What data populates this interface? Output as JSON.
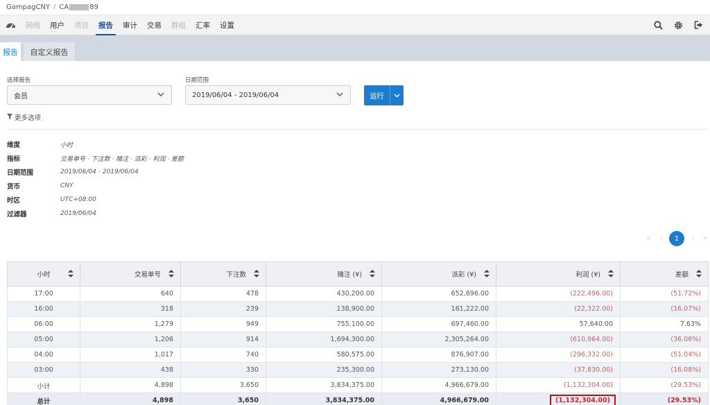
{
  "breadcrumb": {
    "root": "GampagCNY",
    "separator": "/",
    "current_prefix": "CA",
    "current_suffix": "89"
  },
  "nav": {
    "items": [
      {
        "label": "网络",
        "dim": true
      },
      {
        "label": "用户",
        "dim": false
      },
      {
        "label": "项目",
        "dim": true
      },
      {
        "label": "报告",
        "dim": false,
        "active": true
      },
      {
        "label": "审计",
        "dim": false
      },
      {
        "label": "交易",
        "dim": false
      },
      {
        "label": "群组",
        "dim": true
      },
      {
        "label": "汇率",
        "dim": false
      },
      {
        "label": "设置",
        "dim": false
      }
    ]
  },
  "tabs": {
    "reports": "报告",
    "custom": "自定义报告"
  },
  "filters": {
    "report_label": "选择报告",
    "report_value": "会员",
    "date_label": "日期范围",
    "date_value": "2019/06/04 - 2019/06/04",
    "run_label": "运行",
    "more_options": "更多选项"
  },
  "summary": [
    {
      "key": "维度",
      "value": "小时"
    },
    {
      "key": "指标",
      "value": "交易单号 · 下注数 · 赌注 · 派彩 · 利润 · 差额"
    },
    {
      "key": "日期范围",
      "value": "2019/06/04 - 2019/06/04"
    },
    {
      "key": "货币",
      "value": "CNY"
    },
    {
      "key": "时区",
      "value": "UTC+08:00"
    },
    {
      "key": "过滤器",
      "value": "2019/06/04"
    }
  ],
  "pagination": {
    "prev": "‹",
    "first": "«",
    "current": "1",
    "next": "›",
    "last": "»"
  },
  "table": {
    "headers": [
      "小时",
      "交易单号",
      "下注数",
      "赌注 (¥)",
      "派彩 (¥)",
      "利润 (¥)",
      "差额"
    ],
    "rows": [
      [
        "17:00",
        "640",
        "478",
        "430,200.00",
        "652,696.00",
        "(222,496.00)",
        "(51.72%)"
      ],
      [
        "16:00",
        "318",
        "239",
        "138,900.00",
        "161,222.00",
        "(22,322.00)",
        "(16.07%)"
      ],
      [
        "06:00",
        "1,279",
        "949",
        "755,100.00",
        "697,460.00",
        "57,640.00",
        "7.63%"
      ],
      [
        "05:00",
        "1,206",
        "914",
        "1,694,300.00",
        "2,305,264.00",
        "(610,964.00)",
        "(36.06%)"
      ],
      [
        "04:00",
        "1,017",
        "740",
        "580,575.00",
        "876,907.00",
        "(296,332.00)",
        "(51.04%)"
      ],
      [
        "03:00",
        "438",
        "330",
        "235,300.00",
        "273,130.00",
        "(37,830.00)",
        "(16.08%)"
      ]
    ],
    "subtotal": [
      "小计",
      "4,898",
      "3,650",
      "3,834,375.00",
      "4,966,679.00",
      "(1,132,304.00)",
      "(29.53%)"
    ],
    "total": [
      "总计",
      "4,898",
      "3,650",
      "3,834,375.00",
      "4,966,679.00",
      "(1,132,304.00)",
      "(29.53%)"
    ]
  },
  "colors": {
    "accent": "#1c7dd0",
    "negative": "#d55a63",
    "highlight_box": "#b8141e"
  }
}
